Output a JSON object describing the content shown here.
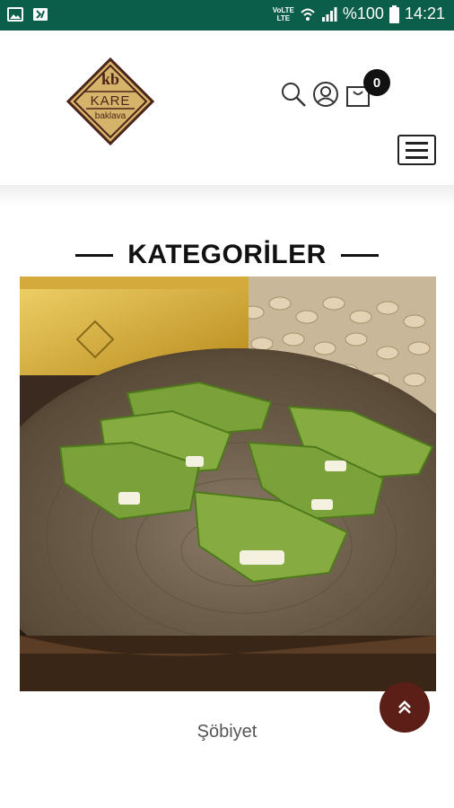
{
  "status_bar": {
    "volte_top": "VoLTE",
    "volte_bottom": "LTE",
    "battery_text": "%100",
    "time": "14:21"
  },
  "header": {
    "logo": {
      "monogram": "kb",
      "brand": "KARE",
      "sub": "baklava"
    },
    "cart_count": "0"
  },
  "section": {
    "title": "KATEGORİLER"
  },
  "product": {
    "name": "Şöbiyet"
  },
  "colors": {
    "status_bar": "#0b5e49",
    "logo_brown": "#4a2418",
    "logo_gold": "#d6b36a",
    "back_to_top": "#5c1f17",
    "pistachio": "#7ba23a"
  }
}
